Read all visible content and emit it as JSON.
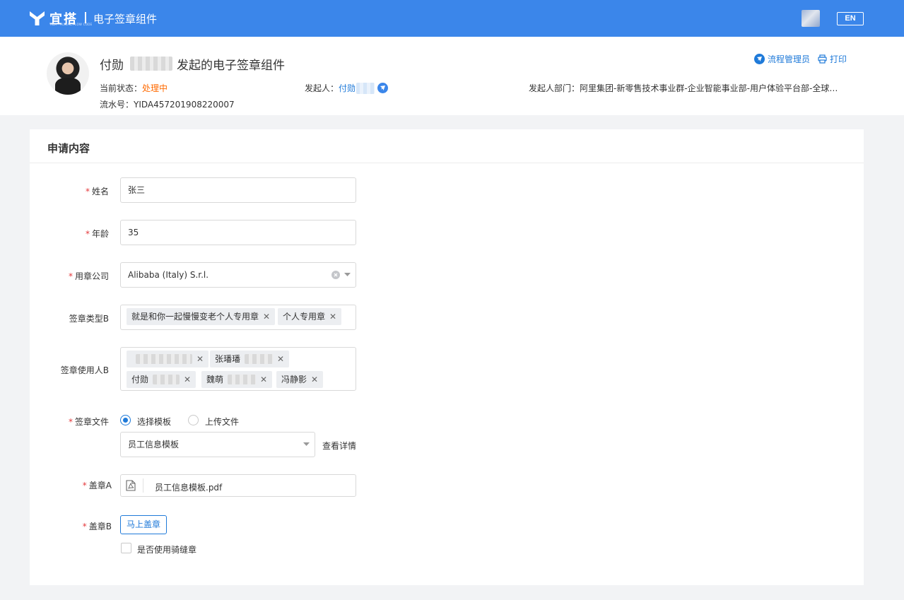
{
  "topbar": {
    "logo_text": "宜搭",
    "logo_sub": "YIDA · ALIBABA LOW CODE",
    "app_title": "电子签章组件",
    "lang_button": "EN"
  },
  "header": {
    "title_prefix": "付勋",
    "title_suffix": "发起的电子签章组件",
    "status_label": "当前状态：",
    "status_value": "处理中",
    "serial_label": "流水号：",
    "serial_value": "YIDA457201908220007",
    "initiator_label": "发起人：",
    "initiator_value": "付勋",
    "dept_label": "发起人部门：",
    "dept_value": "阿里集团-新零售技术事业群-企业智能事业部-用户体验平台部-全球…",
    "action_admin": "流程管理员",
    "action_print": "打印"
  },
  "form": {
    "section_title": "申请内容",
    "name": {
      "label": "姓名",
      "value": "张三"
    },
    "age": {
      "label": "年龄",
      "value": "35"
    },
    "company": {
      "label": "用章公司",
      "value": "Alibaba (Italy) S.r.l."
    },
    "seal_type": {
      "label": "签章类型B",
      "tags": [
        "就是和你一起慢慢变老个人专用章",
        "个人专用章"
      ]
    },
    "seal_users": {
      "label": "签章使用人B",
      "tags": [
        "",
        "张璠璠",
        "付勋",
        "魏萌",
        "冯静影"
      ]
    },
    "seal_file": {
      "label": "签章文件",
      "option_template": "选择模板",
      "option_upload": "上传文件",
      "template_value": "员工信息模板",
      "detail_link": "查看详情"
    },
    "seal_a": {
      "label": "盖章A",
      "file_name": "员工信息模板.pdf"
    },
    "seal_b": {
      "label": "盖章B",
      "button": "马上盖章",
      "checkbox_label": "是否使用骑缝章"
    }
  },
  "colors": {
    "primary": "#3b86ea",
    "link": "#1f7ad9",
    "status": "#ff6a00",
    "required": "#e4393c"
  }
}
